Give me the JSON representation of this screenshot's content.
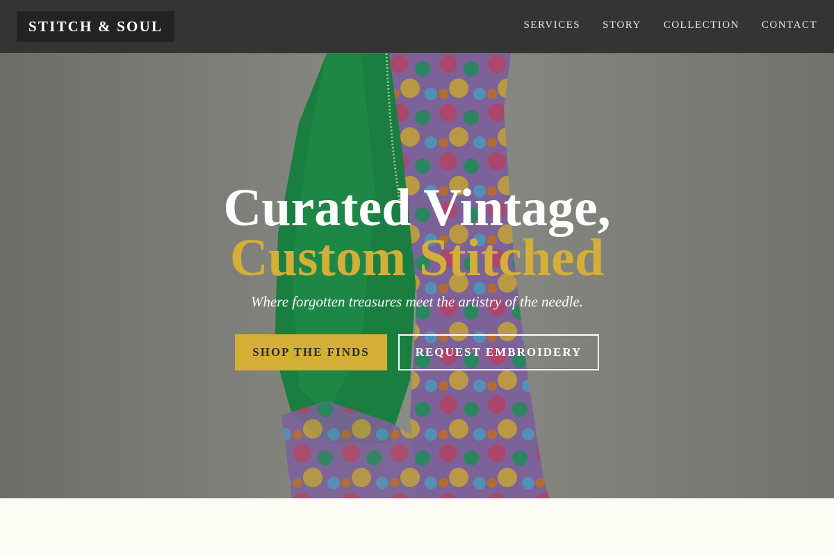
{
  "header": {
    "logo": "STITCH & SOUL",
    "nav": [
      "SERVICES",
      "STORY",
      "COLLECTION",
      "CONTACT"
    ]
  },
  "hero": {
    "heading_line1": "Curated Vintage,",
    "heading_line2": "Custom Stitched",
    "tagline": "Where forgotten treasures meet the artistry of the needle.",
    "primary_button": "SHOP THE FINDS",
    "secondary_button": "REQUEST EMBROIDERY",
    "background_image": "green and floral-print kimono hanging against a grey wall"
  },
  "colors": {
    "nav_bg": "#343434",
    "accent_gold": "#d4af37",
    "page_bg": "#fdfdf5"
  }
}
